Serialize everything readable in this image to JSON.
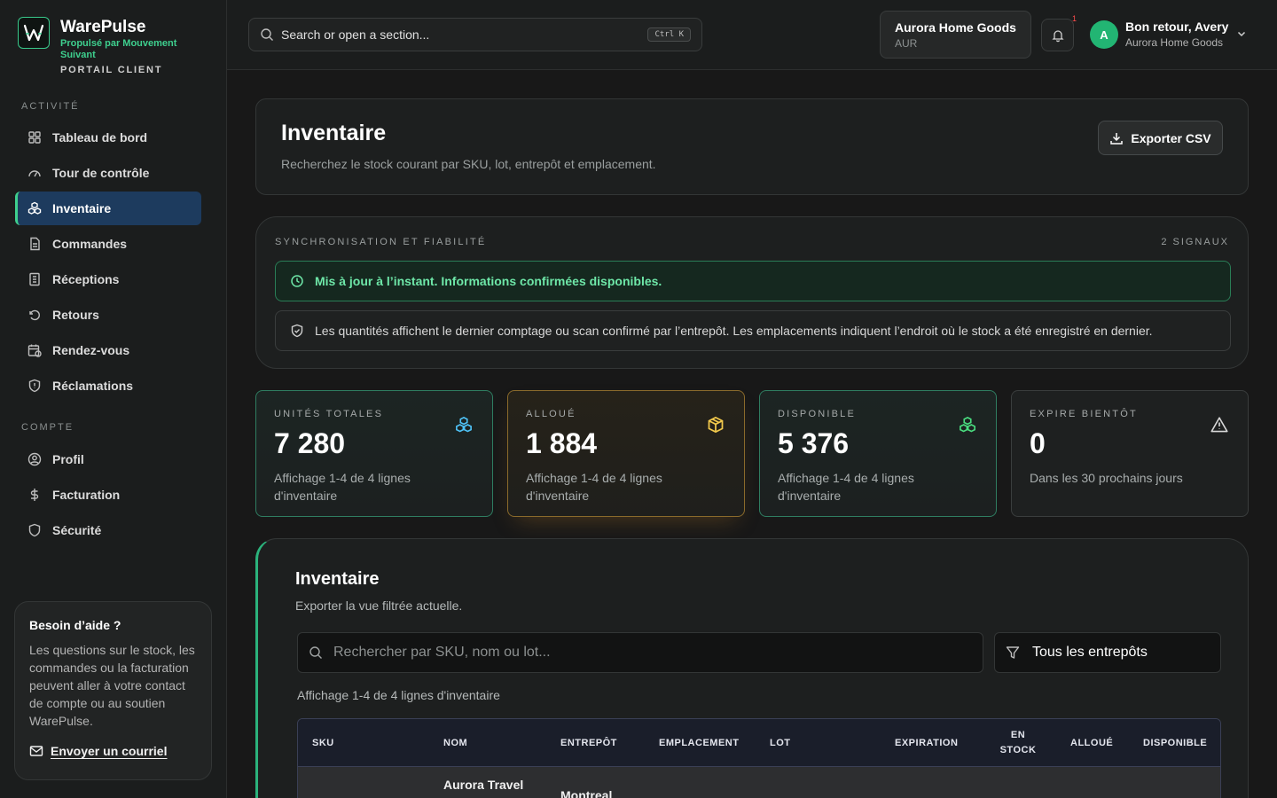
{
  "brand": {
    "name": "WarePulse",
    "tagline": "Propulsé par Mouvement Suivant",
    "portal": "PORTAIL CLIENT"
  },
  "sidebar": {
    "section_activity": "ACTIVITÉ",
    "section_account": "COMPTE",
    "items": [
      {
        "label": "Tableau de bord",
        "icon": "grid-icon"
      },
      {
        "label": "Tour de contrôle",
        "icon": "gauge-icon"
      },
      {
        "label": "Inventaire",
        "icon": "boxes-icon",
        "active": true
      },
      {
        "label": "Commandes",
        "icon": "document-icon"
      },
      {
        "label": "Réceptions",
        "icon": "receipt-icon"
      },
      {
        "label": "Retours",
        "icon": "return-icon"
      },
      {
        "label": "Rendez-vous",
        "icon": "calendar-clock-icon"
      },
      {
        "label": "Réclamations",
        "icon": "shield-alert-icon"
      }
    ],
    "account_items": [
      {
        "label": "Profil",
        "icon": "user-circle-icon"
      },
      {
        "label": "Facturation",
        "icon": "dollar-icon"
      },
      {
        "label": "Sécurité",
        "icon": "shield-icon"
      }
    ],
    "help": {
      "title": "Besoin d’aide ?",
      "text": "Les questions sur le stock, les commandes ou la facturation peuvent aller à votre contact de compte ou au soutien WarePulse.",
      "link": "Envoyer un courriel"
    }
  },
  "topbar": {
    "search_placeholder": "Search or open a section...",
    "shortcut": "Ctrl K",
    "tenant_name": "Aurora Home Goods",
    "tenant_code": "AUR",
    "notification_count": "1",
    "avatar_initial": "A",
    "greeting": "Bon retour, Avery",
    "org": "Aurora Home Goods"
  },
  "header": {
    "title": "Inventaire",
    "subtitle": "Recherchez le stock courant par SKU, lot, entrepôt et emplacement.",
    "export_label": "Exporter CSV"
  },
  "sync": {
    "title": "SYNCHRONISATION ET FIABILITÉ",
    "count": "2 SIGNAUX",
    "ok_message": "Mis à jour à l’instant. Informations confirmées disponibles.",
    "info_message": "Les quantités affichent le dernier comptage ou scan confirmé par l’entrepôt. Les emplacements indiquent l’endroit où le stock a été enregistré en dernier."
  },
  "stats": [
    {
      "label": "UNITÉS TOTALES",
      "value": "7 280",
      "note": "Affichage 1-4 de 4 lignes d'inventaire",
      "icon": "boxes-icon",
      "color": "#4fc3f7"
    },
    {
      "label": "ALLOUÉ",
      "value": "1 884",
      "note": "Affichage 1-4 de 4 lignes d'inventaire",
      "icon": "package-icon",
      "color": "#f2c94c"
    },
    {
      "label": "DISPONIBLE",
      "value": "5 376",
      "note": "Affichage 1-4 de 4 lignes d'inventaire",
      "icon": "boxes-icon",
      "color": "#4ade80"
    },
    {
      "label": "EXPIRE BIENTÔT",
      "value": "0",
      "note": "Dans les 30 prochains jours",
      "icon": "warning-icon",
      "color": "#d8d8d8"
    }
  ],
  "inventory": {
    "title": "Inventaire",
    "subtitle": "Exporter la vue filtrée actuelle.",
    "search_placeholder": "Rechercher par SKU, nom ou lot...",
    "warehouse_filter": "Tous les entrepôts",
    "count_text": "Affichage 1-4 de 4 lignes d'inventaire",
    "columns": [
      "SKU",
      "NOM",
      "ENTREPÔT",
      "EMPLACEMENT",
      "LOT",
      "EXPIRATION",
      "EN STOCK",
      "ALLOUÉ",
      "DISPONIBLE"
    ],
    "rows": [
      {
        "name": "Aurora Travel",
        "warehouse": "Montreal"
      }
    ]
  }
}
